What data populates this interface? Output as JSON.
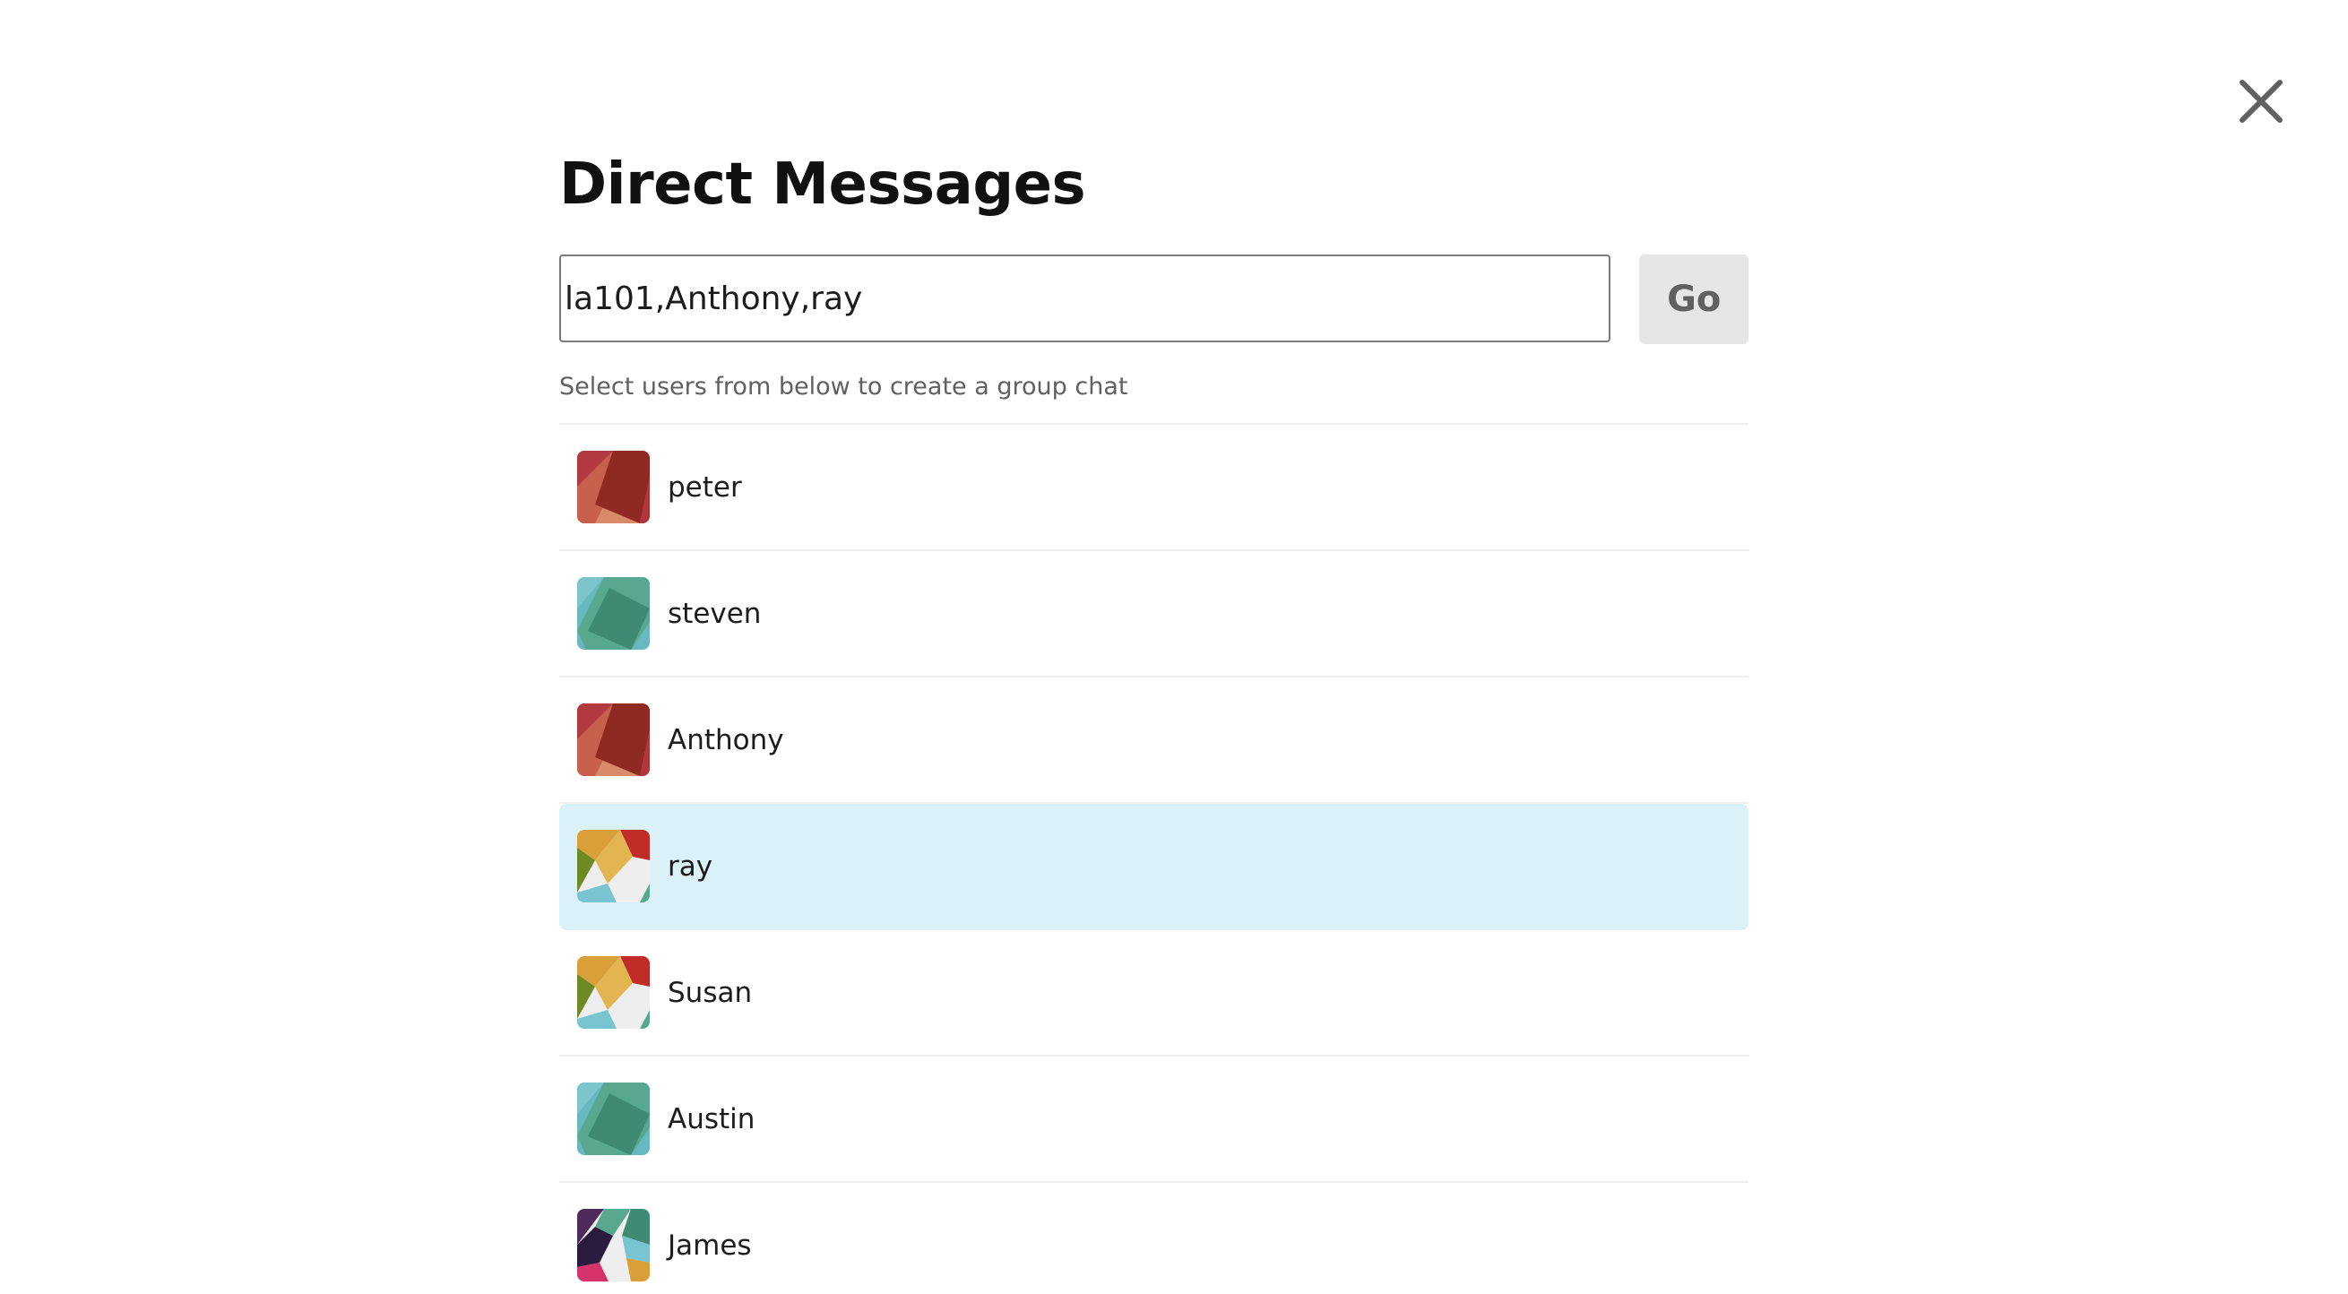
{
  "modal": {
    "title": "Direct Messages",
    "close_icon": "close-icon"
  },
  "search": {
    "value": "la101,Anthony,ray",
    "go_label": "Go",
    "hint": "Select users from below to create a group chat"
  },
  "users": [
    {
      "name": "peter",
      "avatar": "avatar-red",
      "selected": false
    },
    {
      "name": "steven",
      "avatar": "avatar-teal",
      "selected": false
    },
    {
      "name": "Anthony",
      "avatar": "avatar-red",
      "selected": false
    },
    {
      "name": "ray",
      "avatar": "avatar-multicolor",
      "selected": true
    },
    {
      "name": "Susan",
      "avatar": "avatar-multicolor",
      "selected": false
    },
    {
      "name": "Austin",
      "avatar": "avatar-teal",
      "selected": false
    },
    {
      "name": "James",
      "avatar": "avatar-pink-plaid",
      "selected": false
    }
  ],
  "colors": {
    "selected_row": "#dbf1f8",
    "go_button_bg": "#e6e6e6",
    "divider": "#efefef"
  }
}
